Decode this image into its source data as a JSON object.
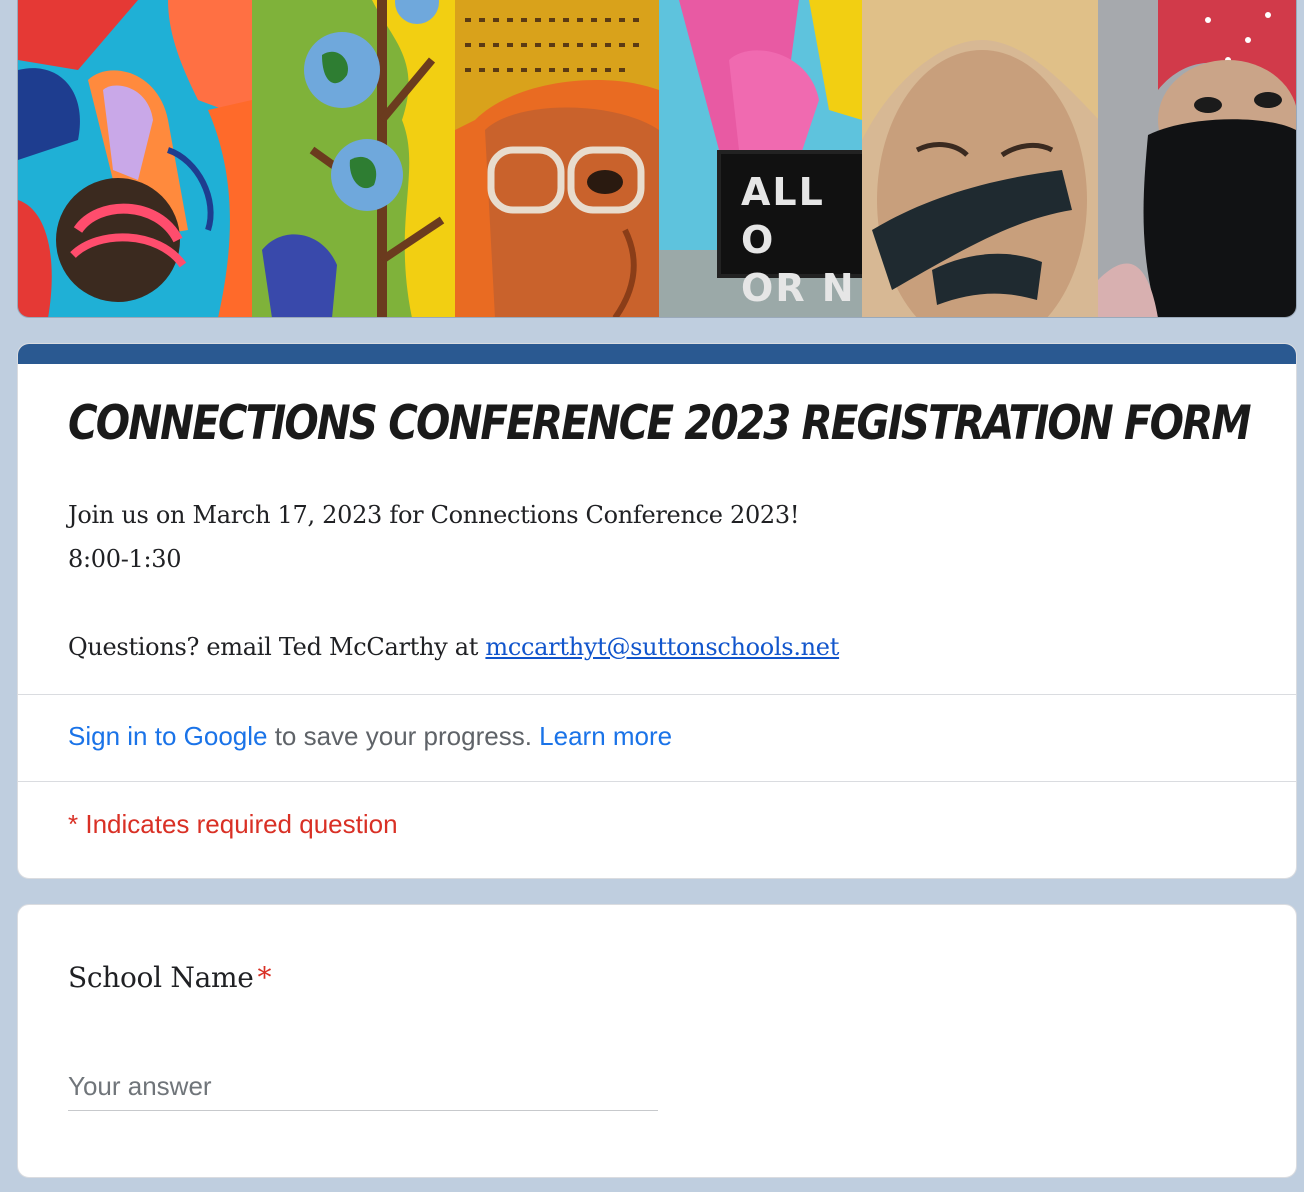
{
  "banner": {
    "sign_lines": [
      "ALL O",
      "OR N"
    ]
  },
  "form": {
    "title": "CONNECTIONS CONFERENCE 2023 REGISTRATION FORM",
    "description_line1": "Join us on March 17, 2023 for Connections Conference 2023!",
    "description_line2": "8:00-1:30",
    "questions_prefix": "Questions? email Ted McCarthy at ",
    "contact_email": "mccarthyt@suttonschools.net",
    "accent_color": "#2a5991"
  },
  "signin": {
    "link_text": "Sign in to Google",
    "middle_text": " to save your progress. ",
    "learn_more": "Learn more"
  },
  "required_note": "* Indicates required question",
  "question": {
    "label": "School Name",
    "required_marker": "*",
    "placeholder": "Your answer",
    "value": ""
  }
}
